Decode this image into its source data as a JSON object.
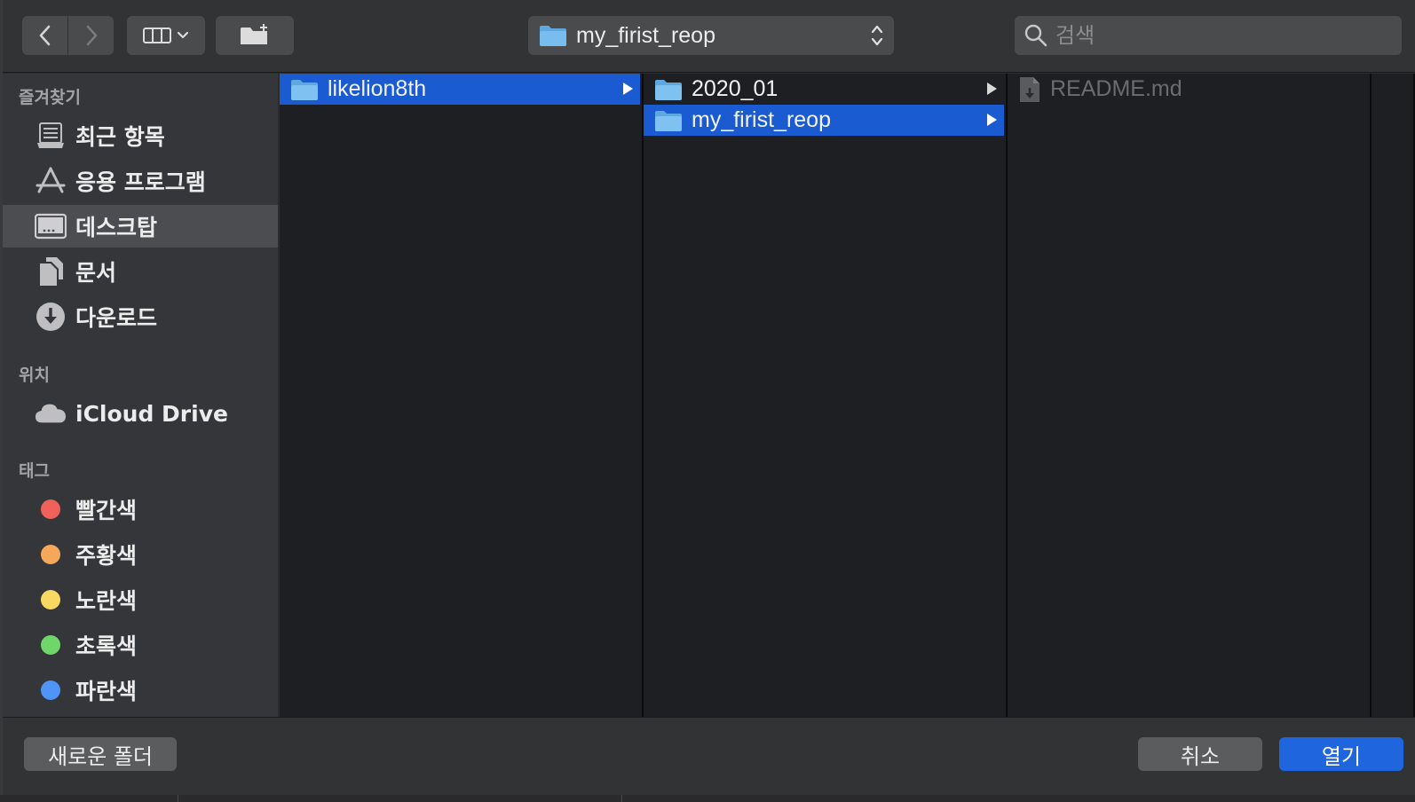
{
  "toolbar": {
    "path_label": "my_firist_reop",
    "search_placeholder": "검색"
  },
  "sidebar": {
    "favorites_header": "즐겨찾기",
    "favorites": [
      {
        "label": "최근 항목",
        "icon": "recents-icon"
      },
      {
        "label": "응용 프로그램",
        "icon": "applications-icon"
      },
      {
        "label": "데스크탑",
        "icon": "desktop-icon",
        "selected": true
      },
      {
        "label": "문서",
        "icon": "documents-icon"
      },
      {
        "label": "다운로드",
        "icon": "downloads-icon"
      }
    ],
    "locations_header": "위치",
    "locations": [
      {
        "label": "iCloud Drive",
        "icon": "icloud-icon"
      }
    ],
    "tags_header": "태그",
    "tags": [
      {
        "label": "빨간색",
        "color": "#f0615a"
      },
      {
        "label": "주황색",
        "color": "#f5a85a"
      },
      {
        "label": "노란색",
        "color": "#f7d860"
      },
      {
        "label": "초록색",
        "color": "#6fd66a"
      },
      {
        "label": "파란색",
        "color": "#4f95f5"
      }
    ]
  },
  "columns": [
    [
      {
        "label": "likelion8th",
        "selected": true,
        "has_children": true
      }
    ],
    [
      {
        "label": "2020_01",
        "selected": false,
        "has_children": true
      },
      {
        "label": "my_firist_reop",
        "selected": true,
        "has_children": true
      }
    ],
    [
      {
        "label": "README.md",
        "disabled": true
      }
    ]
  ],
  "footer": {
    "new_folder_label": "새로운 폴더",
    "cancel_label": "취소",
    "open_label": "열기"
  },
  "colors": {
    "selection": "#1a5bd1",
    "primary_button": "#1f66de"
  }
}
